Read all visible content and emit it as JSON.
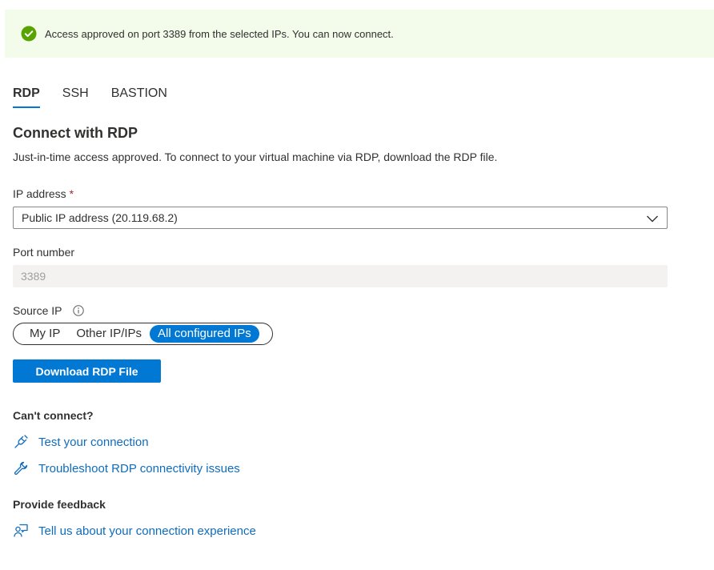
{
  "banner": {
    "status": "success",
    "message": "Access approved on port 3389 from the selected IPs. You can now connect."
  },
  "tabs": [
    {
      "label": "RDP",
      "active": true
    },
    {
      "label": "SSH",
      "active": false
    },
    {
      "label": "BASTION",
      "active": false
    }
  ],
  "connect": {
    "title": "Connect with RDP",
    "description": "Just-in-time access approved. To connect to your virtual machine via RDP, download the RDP file."
  },
  "ip_address": {
    "label": "IP address",
    "required_mark": "*",
    "selected_value": "Public IP address (20.119.68.2)"
  },
  "port_number": {
    "label": "Port number",
    "value": "3389",
    "disabled": true
  },
  "source_ip": {
    "label": "Source IP",
    "options": [
      "My IP",
      "Other IP/IPs",
      "All configured IPs"
    ],
    "selected": "All configured IPs"
  },
  "download_button": {
    "label": "Download RDP File"
  },
  "cant_connect": {
    "heading": "Can't connect?",
    "links": [
      {
        "label": "Test your connection",
        "icon": "plug-icon"
      },
      {
        "label": "Troubleshoot RDP connectivity issues",
        "icon": "wrench-icon"
      }
    ]
  },
  "feedback": {
    "heading": "Provide feedback",
    "links": [
      {
        "label": "Tell us about your connection experience",
        "icon": "feedback-icon"
      }
    ]
  },
  "colors": {
    "accent": "#0078d4",
    "success": "#57a300",
    "banner_bg": "#f3fbeb",
    "link": "#0f6cbd",
    "required": "#a4262c"
  }
}
